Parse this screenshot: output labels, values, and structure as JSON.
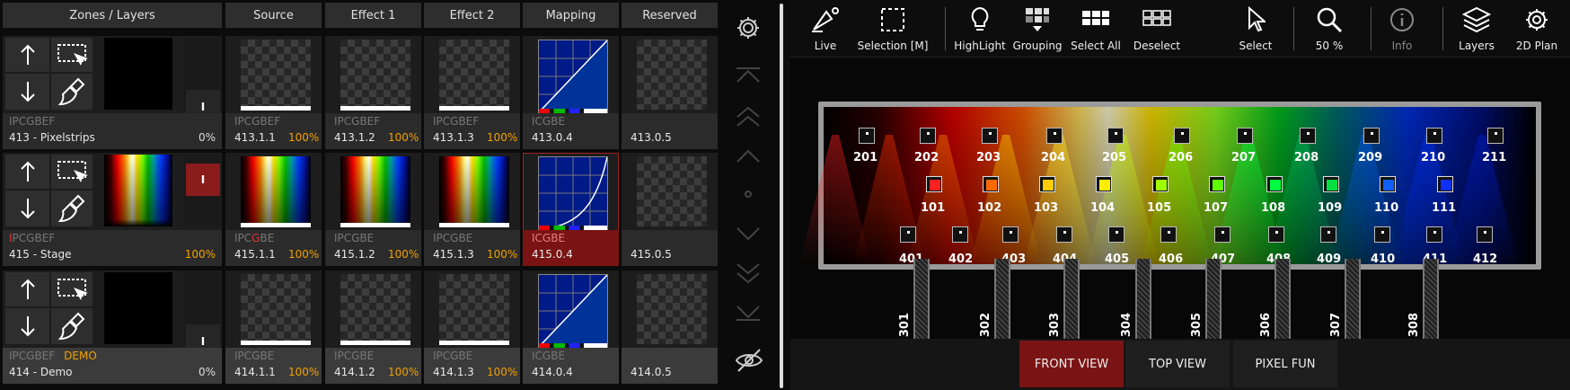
{
  "headers": [
    "Zones / Layers",
    "Source",
    "Effect 1",
    "Effect 2",
    "Mapping",
    "Reserved"
  ],
  "rows": [
    {
      "tag": "IPCGBEF",
      "tagHighlight": "",
      "tagExtra": "",
      "name": "413 - Pixelstrips",
      "pct": "0%",
      "cells": [
        {
          "label": "413.1.1",
          "pct": "100%"
        },
        {
          "label": "413.1.2",
          "pct": "100%"
        },
        {
          "label": "413.1.3",
          "pct": "100%"
        },
        {
          "label": "ICGBE",
          "sub": "413.0.4"
        },
        {
          "label": "",
          "sub": "413.0.5"
        }
      ]
    },
    {
      "tag": "PCGBEF",
      "tagHighlight": "I",
      "tagExtra": "",
      "name": "415 - Stage",
      "pct": "100%",
      "cells": [
        {
          "label": "415.1.1",
          "pct": "100%",
          "tag": "IPCGBE"
        },
        {
          "label": "415.1.2",
          "pct": "100%",
          "tag": "IPCGBE"
        },
        {
          "label": "415.1.3",
          "pct": "100%",
          "tag": "IPCGBE"
        },
        {
          "label": "ICGBE",
          "sub": "415.0.4"
        },
        {
          "label": "",
          "sub": "415.0.5"
        }
      ]
    },
    {
      "tag": "IPCGBEF",
      "tagHighlight": "",
      "tagExtra": "DEMO",
      "name": "414 - Demo",
      "pct": "0%",
      "cells": [
        {
          "label": "414.1.1",
          "pct": "100%",
          "tag": "IPCGBE"
        },
        {
          "label": "414.1.2",
          "pct": "100%",
          "tag": "IPCGBE"
        },
        {
          "label": "414.1.3",
          "pct": "100%",
          "tag": "IPCGBE"
        },
        {
          "label": "ICGBE",
          "sub": "414.0.4"
        },
        {
          "label": "",
          "sub": "414.0.5"
        }
      ]
    }
  ],
  "cellTags": {
    "r0": "IPCGBEF",
    "r2": "IPCGBE"
  },
  "toolbar": [
    {
      "id": "live",
      "label": "Live",
      "icon": "spotlight-icon"
    },
    {
      "id": "selection",
      "label": "Selection [M]",
      "icon": "selection-box-icon"
    },
    {
      "id": "highlight",
      "label": "HighLight",
      "icon": "bulb-icon"
    },
    {
      "id": "grouping",
      "label": "Grouping",
      "icon": "grouping-icon"
    },
    {
      "id": "selectall",
      "label": "Select All",
      "icon": "grid-filled-icon"
    },
    {
      "id": "deselect",
      "label": "Deselect",
      "icon": "grid-empty-icon"
    },
    {
      "id": "select",
      "label": "Select",
      "icon": "cursor-icon"
    },
    {
      "id": "zoom",
      "label": "50 %",
      "icon": "magnifier-icon"
    },
    {
      "id": "info",
      "label": "Info",
      "icon": "info-icon"
    },
    {
      "id": "layers",
      "label": "Layers",
      "icon": "layers-icon"
    },
    {
      "id": "plan2d",
      "label": "2D Plan",
      "icon": "gear-icon"
    }
  ],
  "views": [
    {
      "label": "FRONT VIEW",
      "active": true
    },
    {
      "label": "TOP VIEW",
      "active": false
    },
    {
      "label": "PIXEL FUN",
      "active": false
    }
  ],
  "fixtures_top": [
    "201",
    "202",
    "203",
    "204",
    "205",
    "206",
    "207",
    "208",
    "209",
    "210",
    "211"
  ],
  "fixtures_mid": [
    "101",
    "102",
    "103",
    "104",
    "105",
    "107",
    "108",
    "109",
    "110",
    "111"
  ],
  "fixtures_mid_colors": [
    "#ff2020",
    "#ff6a00",
    "#ffcc00",
    "#ffee00",
    "#a0ff00",
    "#60ff00",
    "#00ff40",
    "#00e040",
    "#1060ff",
    "#1030ff"
  ],
  "fixtures_bot": [
    "401",
    "402",
    "403",
    "404",
    "405",
    "406",
    "407",
    "408",
    "409",
    "410",
    "411",
    "412"
  ],
  "trusses": [
    "301",
    "302",
    "303",
    "304",
    "305",
    "306",
    "307",
    "308"
  ],
  "stepper_label": "I"
}
